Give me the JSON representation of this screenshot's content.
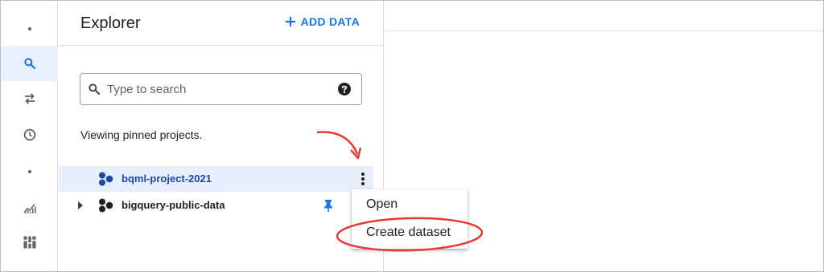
{
  "explorer": {
    "title": "Explorer",
    "add_data_label": "ADD DATA",
    "search": {
      "placeholder": "Type to search",
      "value": ""
    },
    "viewing_text": "Viewing pinned projects.",
    "projects": [
      {
        "label": "bqml-project-2021",
        "selected": true
      },
      {
        "label": "bigquery-public-data",
        "pinned": true
      }
    ]
  },
  "context_menu": {
    "items": [
      {
        "label": "Open"
      },
      {
        "label": "Create dataset",
        "highlighted": true
      }
    ]
  },
  "rail": {
    "items": [
      "dot",
      "search-icon",
      "transfer-icon",
      "history-icon",
      "dot",
      "analytics-icon",
      "dashboard-icon"
    ],
    "active": "search-icon"
  },
  "colors": {
    "accent": "#1a73e8",
    "annotation": "#e53935",
    "selected_row": "#e8eefb"
  }
}
